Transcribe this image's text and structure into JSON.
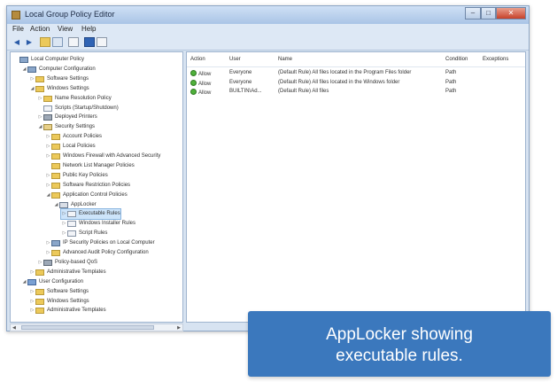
{
  "window": {
    "title": "Local Group Policy Editor",
    "controls": {
      "minimize": "–",
      "maximize": "□",
      "close": "✕"
    }
  },
  "menu": [
    "File",
    "Action",
    "View",
    "Help"
  ],
  "toolbar": {
    "icons": [
      "back-arrow-icon",
      "forward-arrow-icon",
      "folder-up-icon",
      "show-hide-tree-icon",
      "export-icon",
      "help-icon",
      "properties-icon"
    ]
  },
  "tree": [
    {
      "label": "Local Computer Policy",
      "icon": "computer",
      "indent": 0,
      "toggle": ""
    },
    {
      "label": "Computer Configuration",
      "icon": "computer",
      "indent": 1,
      "toggle": "◢"
    },
    {
      "label": "Software Settings",
      "icon": "folder",
      "indent": 2,
      "toggle": "▷"
    },
    {
      "label": "Windows Settings",
      "icon": "folder",
      "indent": 2,
      "toggle": "◢"
    },
    {
      "label": "Name Resolution Policy",
      "icon": "folder",
      "indent": 3,
      "toggle": "▷"
    },
    {
      "label": "Scripts (Startup/Shutdown)",
      "icon": "doc",
      "indent": 3,
      "toggle": ""
    },
    {
      "label": "Deployed Printers",
      "icon": "gear",
      "indent": 3,
      "toggle": "▷"
    },
    {
      "label": "Security Settings",
      "icon": "sec",
      "indent": 3,
      "toggle": "◢"
    },
    {
      "label": "Account Policies",
      "icon": "folder",
      "indent": 4,
      "toggle": "▷"
    },
    {
      "label": "Local Policies",
      "icon": "folder",
      "indent": 4,
      "toggle": "▷"
    },
    {
      "label": "Windows Firewall with Advanced Security",
      "icon": "folder",
      "indent": 4,
      "toggle": "▷"
    },
    {
      "label": "Network List Manager Policies",
      "icon": "folder",
      "indent": 4,
      "toggle": ""
    },
    {
      "label": "Public Key Policies",
      "icon": "folder",
      "indent": 4,
      "toggle": "▷"
    },
    {
      "label": "Software Restriction Policies",
      "icon": "folder",
      "indent": 4,
      "toggle": "▷"
    },
    {
      "label": "Application Control Policies",
      "icon": "folder",
      "indent": 4,
      "toggle": "◢"
    },
    {
      "label": "AppLocker",
      "icon": "apl",
      "indent": 5,
      "toggle": "◢"
    },
    {
      "label": "Executable Rules",
      "icon": "doc",
      "indent": 6,
      "toggle": "▷",
      "selected": true
    },
    {
      "label": "Windows Installer Rules",
      "icon": "doc",
      "indent": 6,
      "toggle": "▷"
    },
    {
      "label": "Script Rules",
      "icon": "doc",
      "indent": 6,
      "toggle": "▷"
    },
    {
      "label": "IP Security Policies on Local Computer",
      "icon": "comp",
      "indent": 4,
      "toggle": "▷"
    },
    {
      "label": "Advanced Audit Policy Configuration",
      "icon": "folder",
      "indent": 4,
      "toggle": "▷"
    },
    {
      "label": "Policy-based QoS",
      "icon": "gear",
      "indent": 3,
      "toggle": "▷"
    },
    {
      "label": "Administrative Templates",
      "icon": "folder",
      "indent": 2,
      "toggle": "▷"
    },
    {
      "label": "User Configuration",
      "icon": "user",
      "indent": 1,
      "toggle": "◢"
    },
    {
      "label": "Software Settings",
      "icon": "folder",
      "indent": 2,
      "toggle": "▷"
    },
    {
      "label": "Windows Settings",
      "icon": "folder",
      "indent": 2,
      "toggle": "▷"
    },
    {
      "label": "Administrative Templates",
      "icon": "folder",
      "indent": 2,
      "toggle": "▷"
    }
  ],
  "list": {
    "columns": [
      "Action",
      "User",
      "Name",
      "Condition",
      "Exceptions"
    ],
    "rows": [
      {
        "action": "Allow",
        "user": "Everyone",
        "name": "(Default Rule) All files located in the Program Files folder",
        "condition": "Path",
        "exceptions": ""
      },
      {
        "action": "Allow",
        "user": "Everyone",
        "name": "(Default Rule) All files located in the Windows folder",
        "condition": "Path",
        "exceptions": ""
      },
      {
        "action": "Allow",
        "user": "BUILTIN\\Ad...",
        "name": "(Default Rule) All files",
        "condition": "Path",
        "exceptions": ""
      }
    ]
  },
  "scrollbar": {
    "left_arrow": "◀",
    "right_arrow": "▶"
  },
  "callout": {
    "line1": "AppLocker showing",
    "line2": "executable rules."
  }
}
